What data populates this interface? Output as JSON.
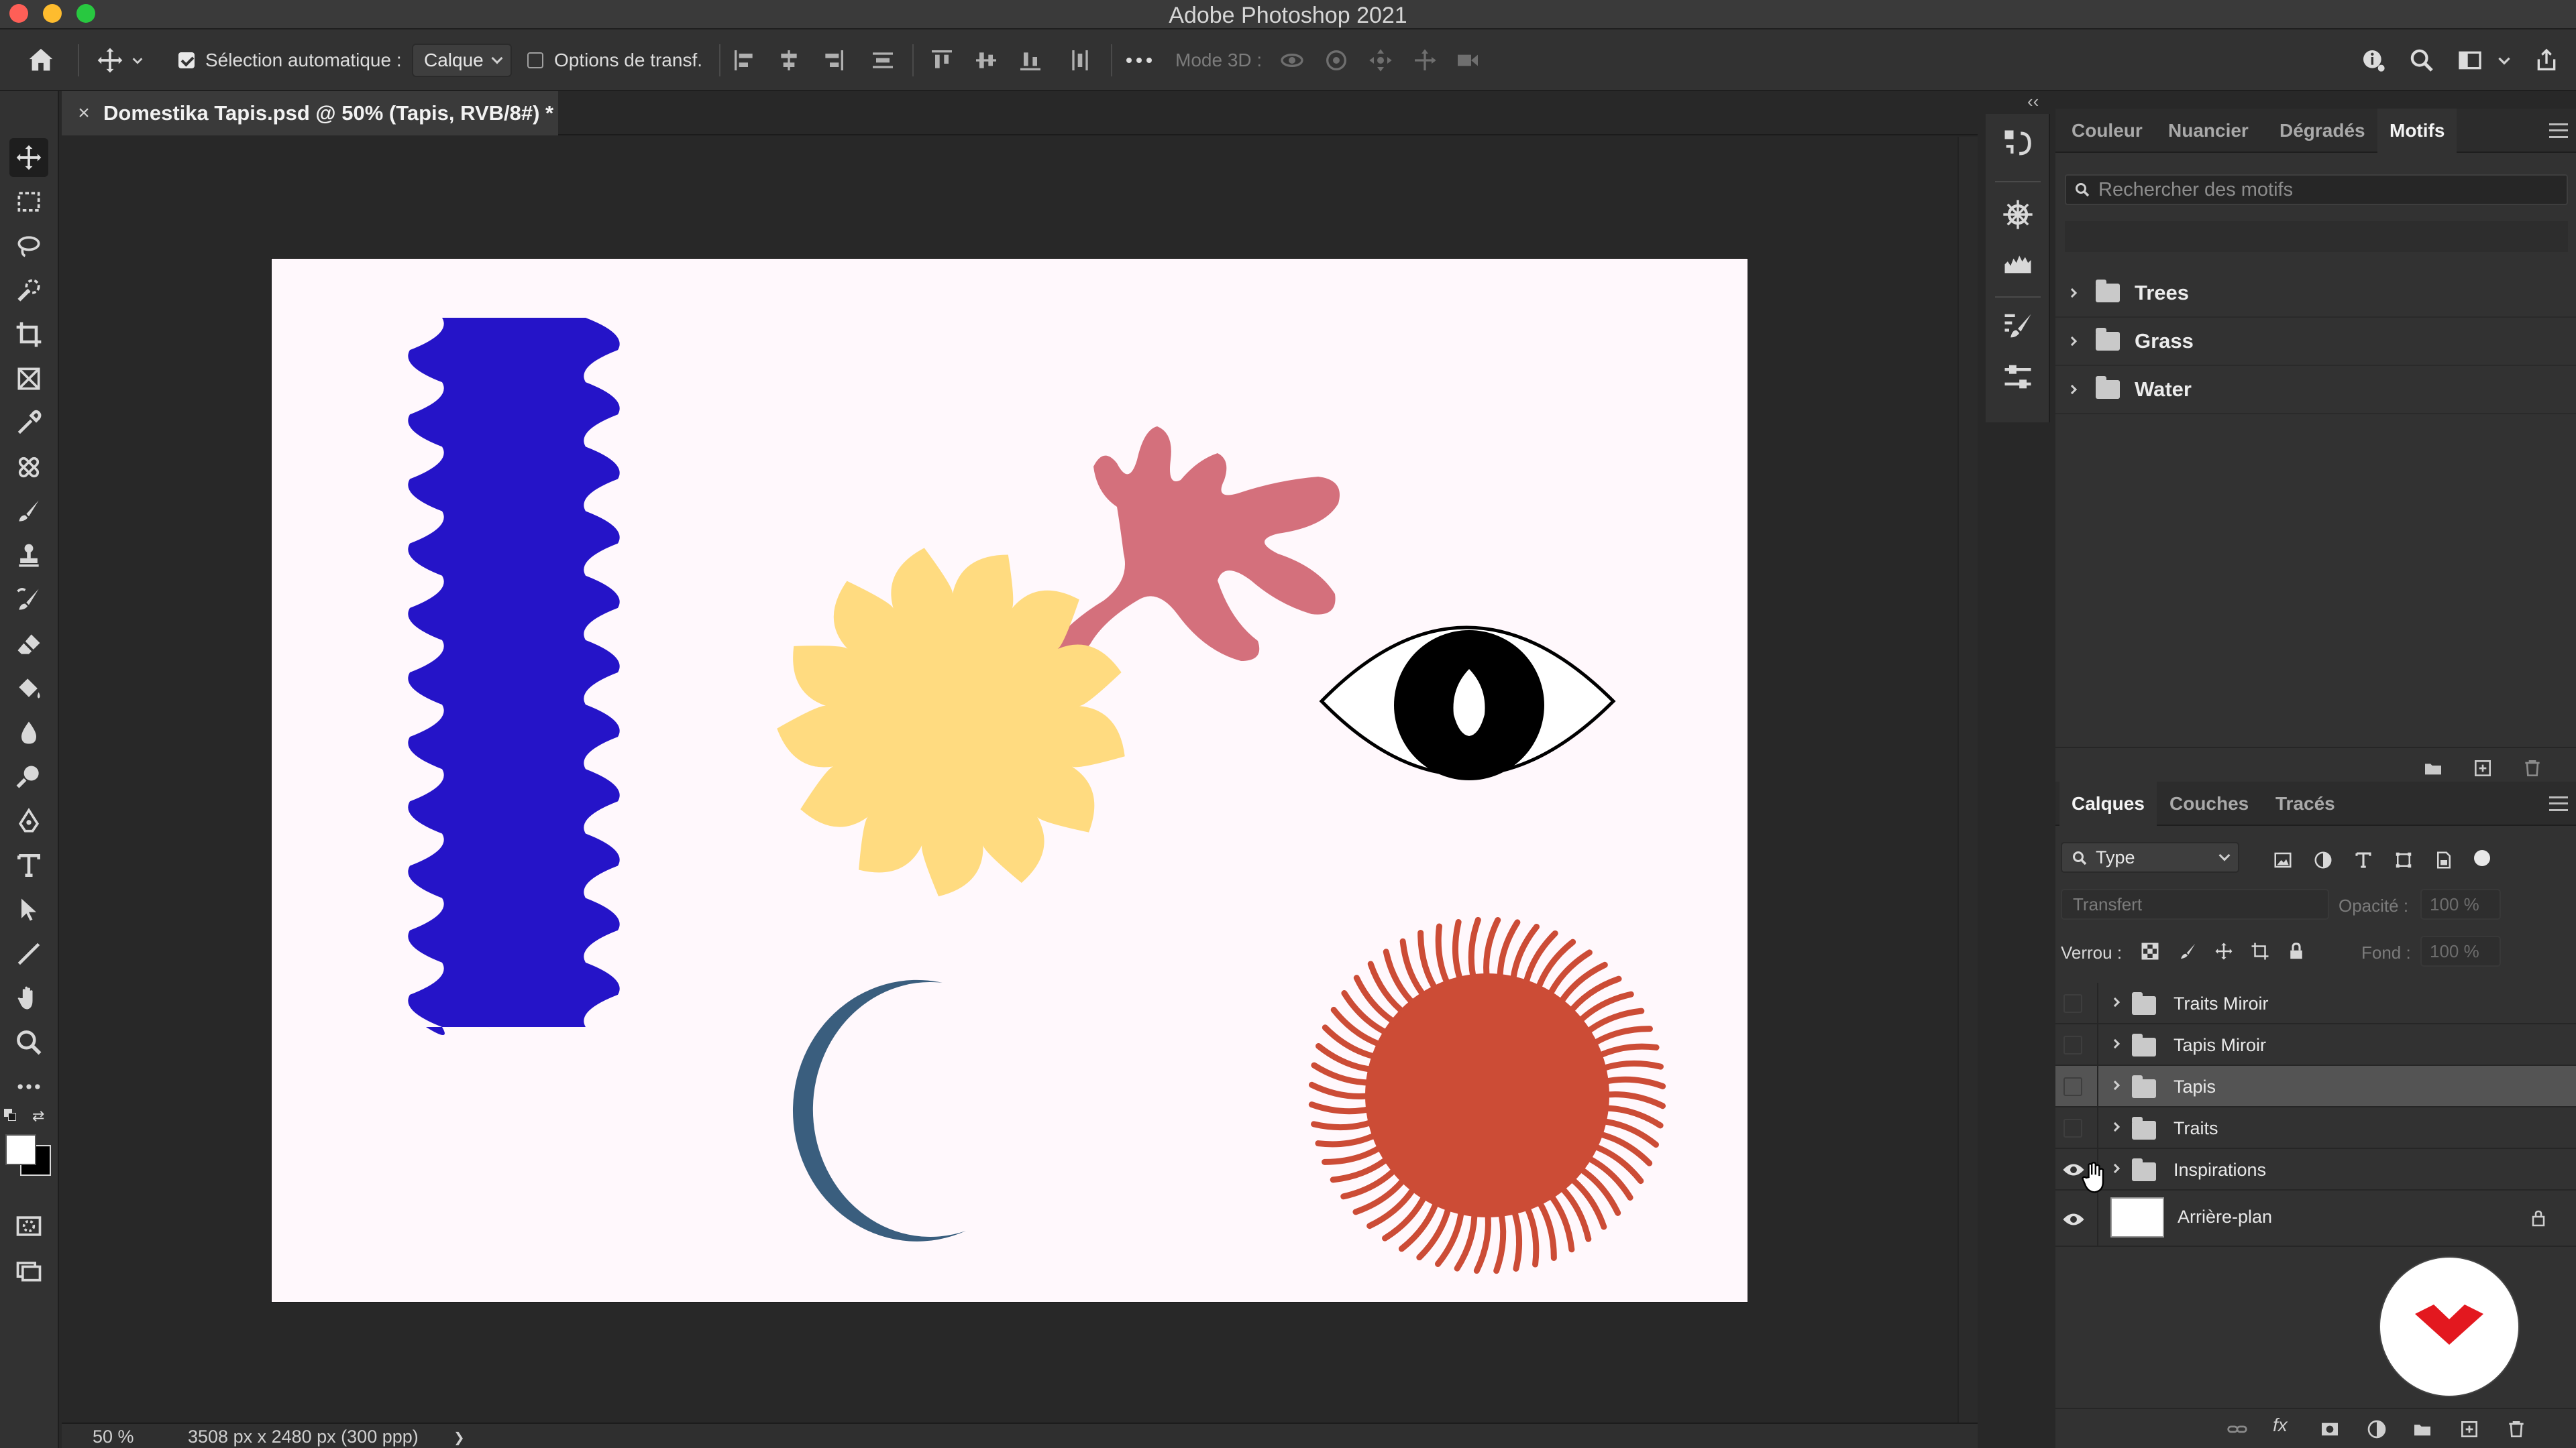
{
  "window": {
    "title": "Adobe Photoshop 2021"
  },
  "options_bar": {
    "auto_select_label": "Sélection automatique :",
    "auto_select_checked": true,
    "auto_select_value": "Calque",
    "transform_label": "Options de transf.",
    "transform_checked": false,
    "mode3d_label": "Mode 3D :"
  },
  "document_tab": {
    "close_glyph": "×",
    "title": "Domestika Tapis.psd @ 50% (Tapis, RVB/8#) *"
  },
  "status_bar": {
    "zoom": "50 %",
    "doc_info": "3508 px x 2480 px (300 ppp)",
    "arrow": "❯"
  },
  "patterns_panel": {
    "tabs": [
      "Couleur",
      "Nuancier",
      "Dégradés",
      "Motifs"
    ],
    "active_tab": "Motifs",
    "search_placeholder": "Rechercher des motifs",
    "items": [
      {
        "label": "Trees"
      },
      {
        "label": "Grass"
      },
      {
        "label": "Water"
      }
    ]
  },
  "layers_panel": {
    "tabs": [
      "Calques",
      "Couches",
      "Tracés"
    ],
    "active_tab": "Calques",
    "filter_value": "Type",
    "blend_mode": "Transfert",
    "opacity_label": "Opacité :",
    "opacity_value": "100 %",
    "lock_label": "Verrou :",
    "fill_label": "Fond :",
    "fill_value": "100 %",
    "layers": [
      {
        "name": "Traits Miroir",
        "type": "group",
        "visible": false,
        "selected": false
      },
      {
        "name": "Tapis Miroir",
        "type": "group",
        "visible": false,
        "selected": false
      },
      {
        "name": "Tapis",
        "type": "group",
        "visible": false,
        "selected": true
      },
      {
        "name": "Traits",
        "type": "group",
        "visible": false,
        "selected": false
      },
      {
        "name": "Inspirations",
        "type": "group",
        "visible": true,
        "selected": false
      },
      {
        "name": "Arrière-plan",
        "type": "background",
        "visible": true,
        "selected": false,
        "locked": true
      }
    ]
  },
  "colors": {
    "wave_blue": "#2514c8",
    "coral_pink": "#d4707c",
    "sun_yellow": "#ffdb80",
    "moon_blue": "#3a5e7e",
    "sun_red": "#cc4c36",
    "canvas_bg": "#fff8fc",
    "logo_red": "#e3181f"
  },
  "icons": {
    "toolbar": [
      "move-icon",
      "marquee-icon",
      "lasso-icon",
      "quick-select-icon",
      "crop-icon",
      "frame-icon",
      "eyedropper-icon",
      "healing-icon",
      "brush-icon",
      "stamp-icon",
      "history-brush-icon",
      "eraser-icon",
      "paint-bucket-icon",
      "blur-icon",
      "dodge-icon",
      "pen-icon",
      "type-icon",
      "path-select-icon",
      "line-icon",
      "hand-icon",
      "zoom-icon",
      "more-icon"
    ]
  }
}
